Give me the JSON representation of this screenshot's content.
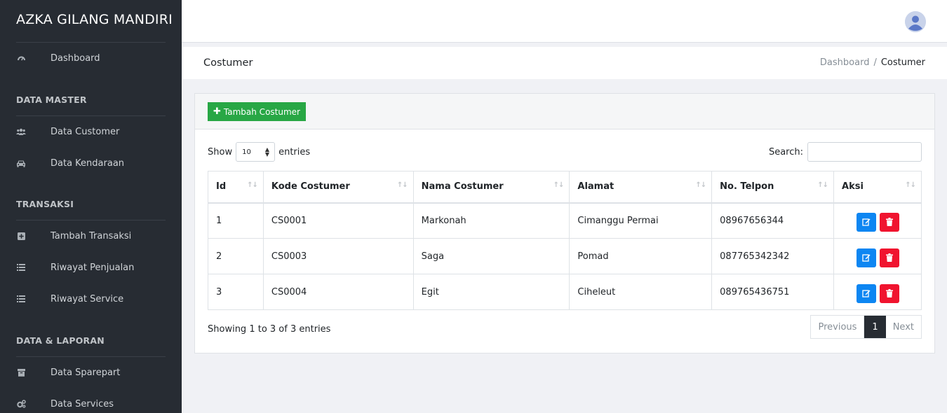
{
  "app": {
    "brand": "AZKA GILANG MANDIRI"
  },
  "sidebar": {
    "dashboard": {
      "label": "Dashboard",
      "icon": "dashboard-icon"
    },
    "sections": [
      {
        "title": "DATA MASTER",
        "items": [
          {
            "label": "Data Customer",
            "icon": "users-icon"
          },
          {
            "label": "Data Kendaraan",
            "icon": "car-icon"
          }
        ]
      },
      {
        "title": "TRANSAKSI",
        "items": [
          {
            "label": "Tambah Transaksi",
            "icon": "plus-square-icon"
          },
          {
            "label": "Riwayat Penjualan",
            "icon": "list-icon"
          },
          {
            "label": "Riwayat Service",
            "icon": "list-icon"
          }
        ]
      },
      {
        "title": "DATA & LAPORAN",
        "items": [
          {
            "label": "Data Sparepart",
            "icon": "archive-icon"
          },
          {
            "label": "Data Services",
            "icon": "cogs-icon"
          }
        ]
      }
    ]
  },
  "page": {
    "title": "Costumer",
    "breadcrumb": {
      "home": "Dashboard",
      "separator": "/",
      "current": "Costumer"
    }
  },
  "card": {
    "add_button": "Tambah Costumer",
    "show_label": "Show",
    "entries_value": "10",
    "entries_label": "entries",
    "search_label": "Search:",
    "search_value": ""
  },
  "table": {
    "columns": [
      "Id",
      "Kode Costumer",
      "Nama Costumer",
      "Alamat",
      "No. Telpon",
      "Aksi"
    ],
    "rows": [
      {
        "id": "1",
        "kode": "CS0001",
        "nama": "Markonah",
        "alamat": "Cimanggu Permai",
        "telp": "08967656344"
      },
      {
        "id": "2",
        "kode": "CS0003",
        "nama": "Saga",
        "alamat": "Pomad",
        "telp": "087765342342"
      },
      {
        "id": "3",
        "kode": "CS0004",
        "nama": "Egit",
        "alamat": "Ciheleut",
        "telp": "089765436751"
      }
    ]
  },
  "footer": {
    "info": "Showing 1 to 3 of 3 entries",
    "prev": "Previous",
    "page": "1",
    "next": "Next"
  },
  "colors": {
    "sidebar_bg": "#272c33",
    "add_button": "#28a745",
    "edit_button": "#0d86f2",
    "delete_button": "#f0142f"
  }
}
